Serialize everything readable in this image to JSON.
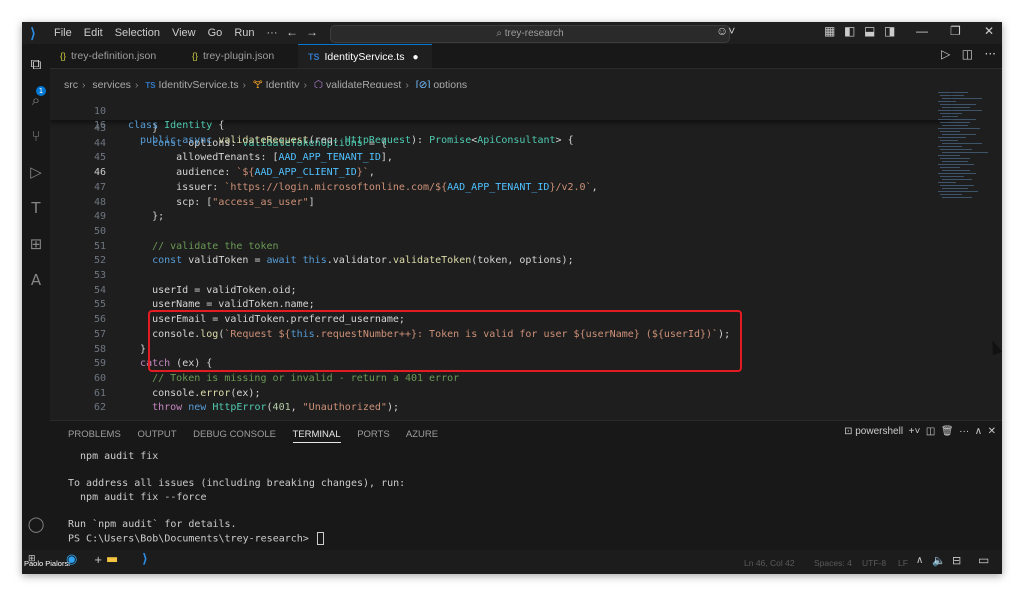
{
  "titlebar": {
    "menu": [
      "File",
      "Edit",
      "Selection",
      "View",
      "Go",
      "Run",
      "···"
    ],
    "search": "trey-research"
  },
  "activity_badge": "1",
  "tabs": [
    {
      "icon": "{}",
      "label": "trey-definition.json"
    },
    {
      "icon": "{}",
      "label": "trey-plugin.json"
    },
    {
      "icon": "TS",
      "label": "IdentityService.ts",
      "dirty": "●"
    }
  ],
  "breadcrumbs": [
    "src",
    "services",
    "IdentityService.ts",
    "Identity",
    "validateRequest",
    "options"
  ],
  "breadcrumb_icons": [
    "TS",
    "🝖",
    "⬡",
    "[⊘]"
  ],
  "editor": {
    "current_line": "46",
    "sticky": [
      {
        "n": "10",
        "text": "class Identity {"
      },
      {
        "n": "16",
        "text": "  public async validateRequest(req: HttpRequest): Promise<ApiConsultant> {"
      }
    ],
    "lines": [
      {
        "n": "43",
        "text": "    }"
      },
      {
        "n": "44",
        "text": "    const options: ValidateTokenOptions = {"
      },
      {
        "n": "45",
        "text": "        allowedTenants: [AAD_APP_TENANT_ID],"
      },
      {
        "n": "46",
        "text": "        audience: `${AAD_APP_CLIENT_ID}`,"
      },
      {
        "n": "47",
        "text": "        issuer: `https://login.microsoftonline.com/${AAD_APP_TENANT_ID}/v2.0`,"
      },
      {
        "n": "48",
        "text": "        scp: [\"access_as_user\"]"
      },
      {
        "n": "49",
        "text": "    };"
      },
      {
        "n": "50",
        "text": ""
      },
      {
        "n": "51",
        "text": "    // validate the token"
      },
      {
        "n": "52",
        "text": "    const validToken = await this.validator.validateToken(token, options);"
      },
      {
        "n": "53",
        "text": ""
      },
      {
        "n": "54",
        "text": "    userId = validToken.oid;"
      },
      {
        "n": "55",
        "text": "    userName = validToken.name;"
      },
      {
        "n": "56",
        "text": "    userEmail = validToken.preferred_username;"
      },
      {
        "n": "57",
        "text": "    console.log(`Request ${this.requestNumber++}: Token is valid for user ${userName} (${userId})`);"
      },
      {
        "n": "58",
        "text": "  }"
      },
      {
        "n": "59",
        "text": "  catch (ex) {"
      },
      {
        "n": "60",
        "text": "    // Token is missing or invalid - return a 401 error"
      },
      {
        "n": "61",
        "text": "    console.error(ex);"
      },
      {
        "n": "62",
        "text": "    throw new HttpError(401, \"Unauthorized\");"
      }
    ]
  },
  "panel": {
    "tabs": [
      "PROBLEMS",
      "OUTPUT",
      "DEBUG CONSOLE",
      "TERMINAL",
      "PORTS",
      "AZURE"
    ],
    "active_tab": "TERMINAL",
    "shell": "powershell",
    "terminal_lines": [
      "  npm audit fix",
      "",
      "To address all issues (including breaking changes), run:",
      "  npm audit fix --force",
      "",
      "Run `npm audit` for details.",
      "PS C:\\Users\\Bob\\Documents\\trey-research> "
    ]
  },
  "statusbar": {
    "position": "Ln 46, Col 42",
    "spaces": "Spaces: 4",
    "encoding": "UTF-8",
    "eol": "LF"
  },
  "taskbar": {
    "user": "Paolo Pialorsi"
  },
  "colors": {
    "highlight": "#e31b23",
    "accent": "#0078d4"
  }
}
